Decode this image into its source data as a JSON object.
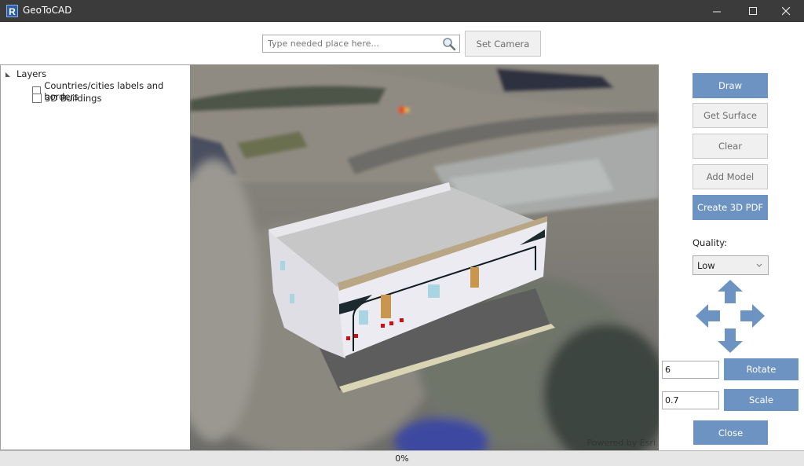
{
  "window": {
    "title": "GeoToCAD",
    "app_icon_letter": "R"
  },
  "search": {
    "placeholder": "Type needed place here...",
    "value": "",
    "icon": "search-icon"
  },
  "toolbar": {
    "set_camera_label": "Set Camera"
  },
  "layers": {
    "root_label": "Layers",
    "expanded": true,
    "items": [
      {
        "label": "Countries/cities labels and borders",
        "checked": false
      },
      {
        "label": "3D Buildings",
        "checked": false
      }
    ]
  },
  "map": {
    "attribution": "Powered by Esri"
  },
  "actions": {
    "draw": "Draw",
    "get_surface": "Get Surface",
    "clear": "Clear",
    "add_model": "Add Model",
    "create_3d_pdf": "Create 3D PDF"
  },
  "quality": {
    "label": "Quality:",
    "selected": "Low"
  },
  "transform": {
    "rotate_value": "6",
    "rotate_label": "Rotate",
    "scale_value": "0.7",
    "scale_label": "Scale"
  },
  "close_label": "Close",
  "progress": {
    "percent": 0,
    "text": "0%"
  },
  "colors": {
    "accent": "#6d93c2",
    "titlebar": "#3b3b3b"
  }
}
